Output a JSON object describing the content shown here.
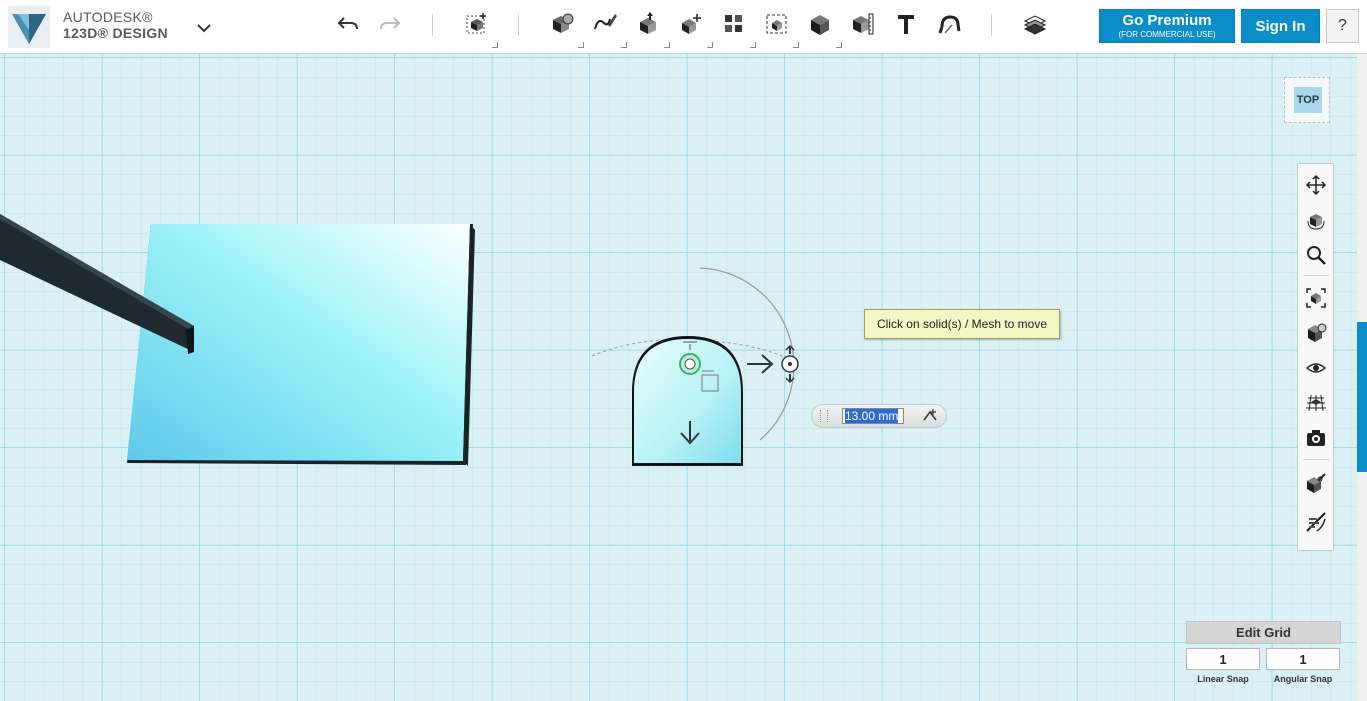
{
  "app": {
    "brand_line1": "AUTODESK®",
    "brand_line2": "123D® DESIGN"
  },
  "toolbar": {
    "tools": [
      "undo-icon",
      "redo-icon",
      "new-object-icon",
      "primitives-icon",
      "sketch-icon",
      "construct-icon",
      "modify-icon",
      "pattern-icon",
      "grouping-icon",
      "combine-icon",
      "measure-icon",
      "text-icon",
      "snap-icon",
      "materials-icon"
    ],
    "premium_label": "Go Premium",
    "premium_sub": "(FOR COMMERCIAL USE)",
    "signin_label": "Sign In",
    "help_label": "?"
  },
  "viewcube": {
    "face_label": "TOP"
  },
  "tooltip": {
    "text": "Click on solid(s) / Mesh to move"
  },
  "dimension": {
    "value": "13.00 mm"
  },
  "grid": {
    "edit_label": "Edit Grid",
    "linear_snap_value": "1",
    "angular_snap_value": "1",
    "linear_snap_label": "Linear Snap",
    "angular_snap_label": "Angular Snap"
  },
  "colors": {
    "accent": "#0b8dc9",
    "grid_bg": "#dbf0f4",
    "grid_major": "#8fd1e6",
    "grid_minor": "#bde4ef",
    "solid": "#8eeaf5",
    "tooltip_bg": "#f3f7c4"
  },
  "navbar": {
    "tools": [
      "pan-icon",
      "orbit-icon",
      "zoom-icon",
      "fit-icon",
      "view-style-icon",
      "visibility-icon",
      "grid-toggle-icon",
      "snapshot-icon",
      "material-edit-icon",
      "hide-icon"
    ]
  }
}
